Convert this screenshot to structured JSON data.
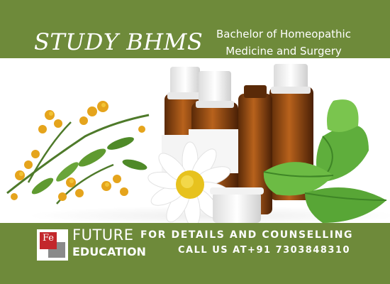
{
  "header": {
    "title": "STUDY BHMS",
    "subtitle_line1": "Bachelor of Homeopathic",
    "subtitle_line2": "Medicine and Surgery"
  },
  "logo": {
    "mark": "Fe",
    "name_line1": "FUTURE",
    "name_line2": "EDUCATION"
  },
  "footer": {
    "details": "FOR DETAILS AND COUNSELLING",
    "call": "CALL US AT+91 7303848310"
  },
  "photo": {
    "subject": "homeopathic-bottles-with-flowers-and-mint"
  },
  "colors": {
    "band": "#6e8a3a",
    "brand_red": "#c3272b",
    "text": "#ffffff"
  }
}
